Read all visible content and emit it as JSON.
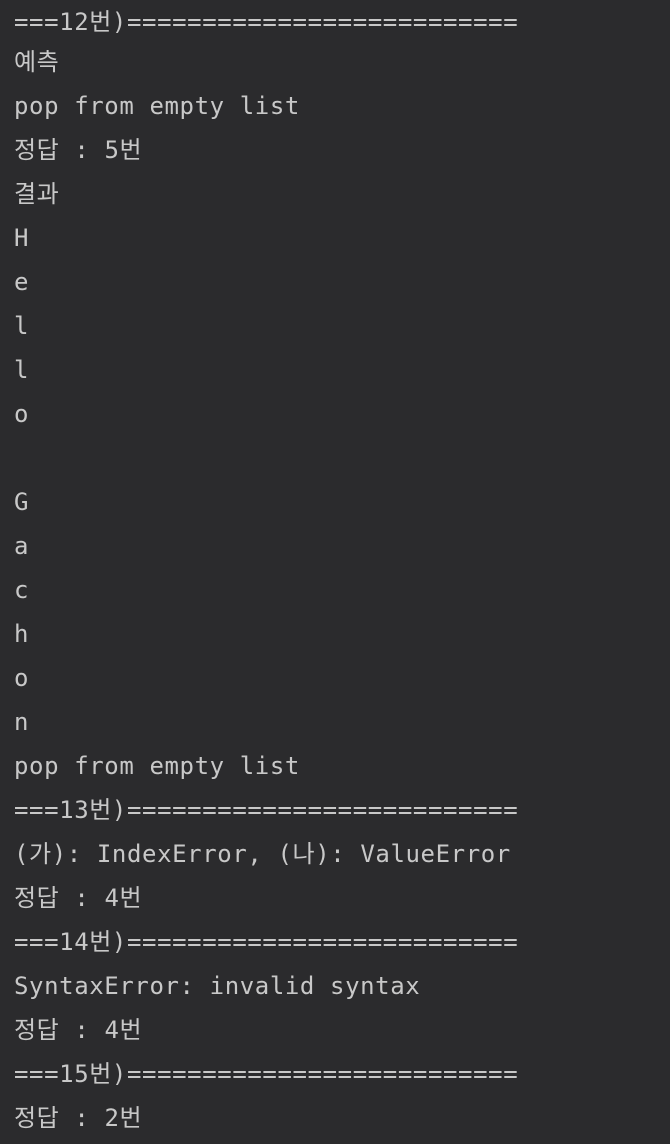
{
  "console": {
    "lines": [
      "===12번)==========================",
      "예측",
      "pop from empty list",
      "정답 : 5번",
      "결과",
      "H",
      "e",
      "l",
      "l",
      "o",
      "",
      "G",
      "a",
      "c",
      "h",
      "o",
      "n",
      "pop from empty list",
      "===13번)==========================",
      "(가): IndexError, (나): ValueError",
      "정답 : 4번",
      "===14번)==========================",
      "SyntaxError: invalid syntax",
      "정답 : 4번",
      "===15번)==========================",
      "정답 : 2번"
    ]
  },
  "colors": {
    "background": "#2b2b2d",
    "text": "#c8c8c8"
  }
}
